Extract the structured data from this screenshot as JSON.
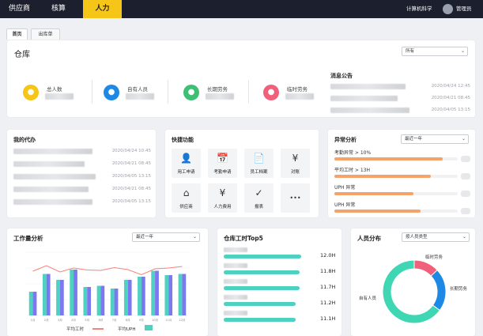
{
  "topbar": {
    "nav": [
      {
        "label": "供应商",
        "active": false
      },
      {
        "label": "核算",
        "active": false
      },
      {
        "label": "人力",
        "active": true
      }
    ],
    "org": "计算机科学",
    "user": "管理员"
  },
  "tabs": [
    {
      "label": "首页",
      "active": true
    },
    {
      "label": "出库单",
      "active": false
    }
  ],
  "warehouse": {
    "title": "仓库",
    "filter": "所有",
    "stats": [
      {
        "label": "总人数",
        "color": "#f5c518",
        "icon": "person-icon"
      },
      {
        "label": "自有人员",
        "color": "#1e88e5",
        "icon": "person-icon"
      },
      {
        "label": "长期劳务",
        "color": "#3dbf74",
        "icon": "team-icon"
      },
      {
        "label": "临时劳务",
        "color": "#f0607a",
        "icon": "team-icon"
      }
    ],
    "notice_title": "消息公告",
    "notices": [
      "2020/04/24 12:45",
      "2020/04/21 08:45",
      "2020/04/05 13:15"
    ]
  },
  "todo": {
    "title": "我的代办",
    "times": [
      "2020/04/24 10:45",
      "2020/04/21 08:45",
      "2020/04/05 13:15",
      "2020/04/21 08:45",
      "2020/04/05 13:15"
    ]
  },
  "quick": {
    "title": "快捷功能",
    "items": [
      {
        "label": "用工申请",
        "icon": "user-apply-icon",
        "glyph": "👤"
      },
      {
        "label": "考勤申请",
        "icon": "calendar-icon",
        "glyph": "📅"
      },
      {
        "label": "员工档案",
        "icon": "files-icon",
        "glyph": "📄"
      },
      {
        "label": "对账",
        "icon": "yen-icon",
        "glyph": "¥"
      },
      {
        "label": "供应商",
        "icon": "store-icon",
        "glyph": "⌂"
      },
      {
        "label": "人力费用",
        "icon": "yen-doc-icon",
        "glyph": "¥"
      },
      {
        "label": "报表",
        "icon": "clipboard-icon",
        "glyph": "✓"
      },
      {
        "label": "",
        "icon": "more-icon",
        "glyph": "•••"
      }
    ]
  },
  "anomaly": {
    "title": "异常分析",
    "filter": "最近一年",
    "items": [
      {
        "label": "考勤异常 > 10%",
        "value": 0.88
      },
      {
        "label": "平均工时 > 13H",
        "value": 0.78
      },
      {
        "label": "UPH 异常",
        "value": 0.64
      },
      {
        "label": "UPH 异常",
        "value": 0.7
      }
    ],
    "color": "#f5a36a"
  },
  "workload": {
    "title": "工作量分析",
    "filter": "最近一年",
    "legend_line": "平均工时",
    "legend_bar": "平均UPH"
  },
  "chart_data": [
    {
      "type": "bar",
      "title": "工作量分析",
      "categories": [
        "1月",
        "2月",
        "3月",
        "4月",
        "5月",
        "6月",
        "7月",
        "8月",
        "9月",
        "10月",
        "11月",
        "12月"
      ],
      "series": [
        {
          "name": "平均UPH",
          "values": [
            6.0,
            10.5,
            9.0,
            11.6,
            7.2,
            7.5,
            6.8,
            9.0,
            9.8,
            11.3,
            10.2,
            10.5
          ],
          "colors": [
            "#4ed1c1",
            "#7b78f0"
          ]
        },
        {
          "name": "平均工时",
          "values": [
            11.2,
            12.6,
            11.0,
            12.0,
            11.5,
            11.4,
            12.1,
            11.6,
            10.3,
            11.8,
            12.0,
            12.4
          ],
          "color": "#f4837d"
        }
      ],
      "ylim": [
        0,
        16
      ]
    },
    {
      "type": "bar",
      "title": "仓库工时Top5",
      "categories": [
        "",
        "",
        "",
        "",
        ""
      ],
      "values": [
        12.0,
        11.8,
        11.7,
        11.2,
        11.1
      ],
      "labels": [
        "12.0H",
        "11.8H",
        "11.7H",
        "11.2H",
        "11.1H"
      ],
      "color": "#4ed1c1"
    },
    {
      "type": "pie",
      "title": "人员分布",
      "filter": "按人员类型",
      "slices": [
        {
          "label": "临时劳务",
          "value": 13,
          "color": "#f0607a"
        },
        {
          "label": "长期劳务",
          "value": 22,
          "color": "#1e88e5"
        },
        {
          "label": "自有人员",
          "value": 65,
          "color": "#3fd6b4"
        }
      ]
    }
  ]
}
